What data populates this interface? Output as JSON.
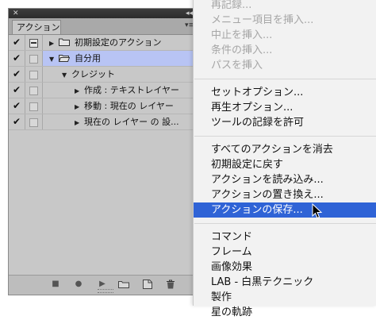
{
  "panel": {
    "close_glyph": "✕",
    "collapse_glyph": "◂◂",
    "tab_label": "アクション",
    "menu_glyph": "▾≡",
    "rows": [
      {
        "check": "✔",
        "dialog": "dash",
        "indent": 0,
        "expander": "▶",
        "folder": true,
        "label": "初期設定のアクション",
        "selected": false
      },
      {
        "check": "✔",
        "dialog": "box",
        "indent": 0,
        "expander": "▼",
        "folder": true,
        "open": true,
        "label": "自分用",
        "selected": true
      },
      {
        "check": "✔",
        "dialog": "box",
        "indent": 1,
        "expander": "▼",
        "folder": false,
        "label": "クレジット",
        "selected": false
      },
      {
        "check": "✔",
        "dialog": "box",
        "indent": 2,
        "expander": "▶",
        "folder": false,
        "label": "作成 : テキストレイヤー",
        "selected": false
      },
      {
        "check": "✔",
        "dialog": "box",
        "indent": 2,
        "expander": "▶",
        "folder": false,
        "label": "移動 : 現在の レイヤー",
        "selected": false
      },
      {
        "check": "✔",
        "dialog": "box",
        "indent": 2,
        "expander": "▶",
        "folder": false,
        "label": "現在の レイヤー の 設...",
        "selected": false
      }
    ],
    "toolbar": {
      "stop_glyph": "■",
      "record_glyph": "●",
      "play_glyph": "▶"
    }
  },
  "menu": {
    "groups": [
      [
        {
          "label": "再記録...",
          "disabled": true
        },
        {
          "label": "メニュー項目を挿入...",
          "disabled": true
        },
        {
          "label": "中止を挿入...",
          "disabled": true
        },
        {
          "label": "条件の挿入...",
          "disabled": true
        },
        {
          "label": "パスを挿入",
          "disabled": true
        }
      ],
      [
        {
          "label": "セットオプション...",
          "disabled": false
        },
        {
          "label": "再生オプション...",
          "disabled": false
        },
        {
          "label": "ツールの記録を許可",
          "disabled": false
        }
      ],
      [
        {
          "label": "すべてのアクションを消去",
          "disabled": false
        },
        {
          "label": "初期設定に戻す",
          "disabled": false
        },
        {
          "label": "アクションを読み込み...",
          "disabled": false
        },
        {
          "label": "アクションの置き換え...",
          "disabled": false
        },
        {
          "label": "アクションの保存...",
          "disabled": false,
          "highlight": true
        }
      ],
      [
        {
          "label": "コマンド",
          "disabled": false
        },
        {
          "label": "フレーム",
          "disabled": false
        },
        {
          "label": "画像効果",
          "disabled": false
        },
        {
          "label": "LAB - 白黒テクニック",
          "disabled": false
        },
        {
          "label": "製作",
          "disabled": false
        },
        {
          "label": "星の軌跡",
          "disabled": false
        }
      ]
    ]
  },
  "colors": {
    "highlight": "#2f63d6",
    "selected_row": "#b8c4f4",
    "panel_bg": "#c8c8c8",
    "menu_bg": "#f2f2f2"
  }
}
